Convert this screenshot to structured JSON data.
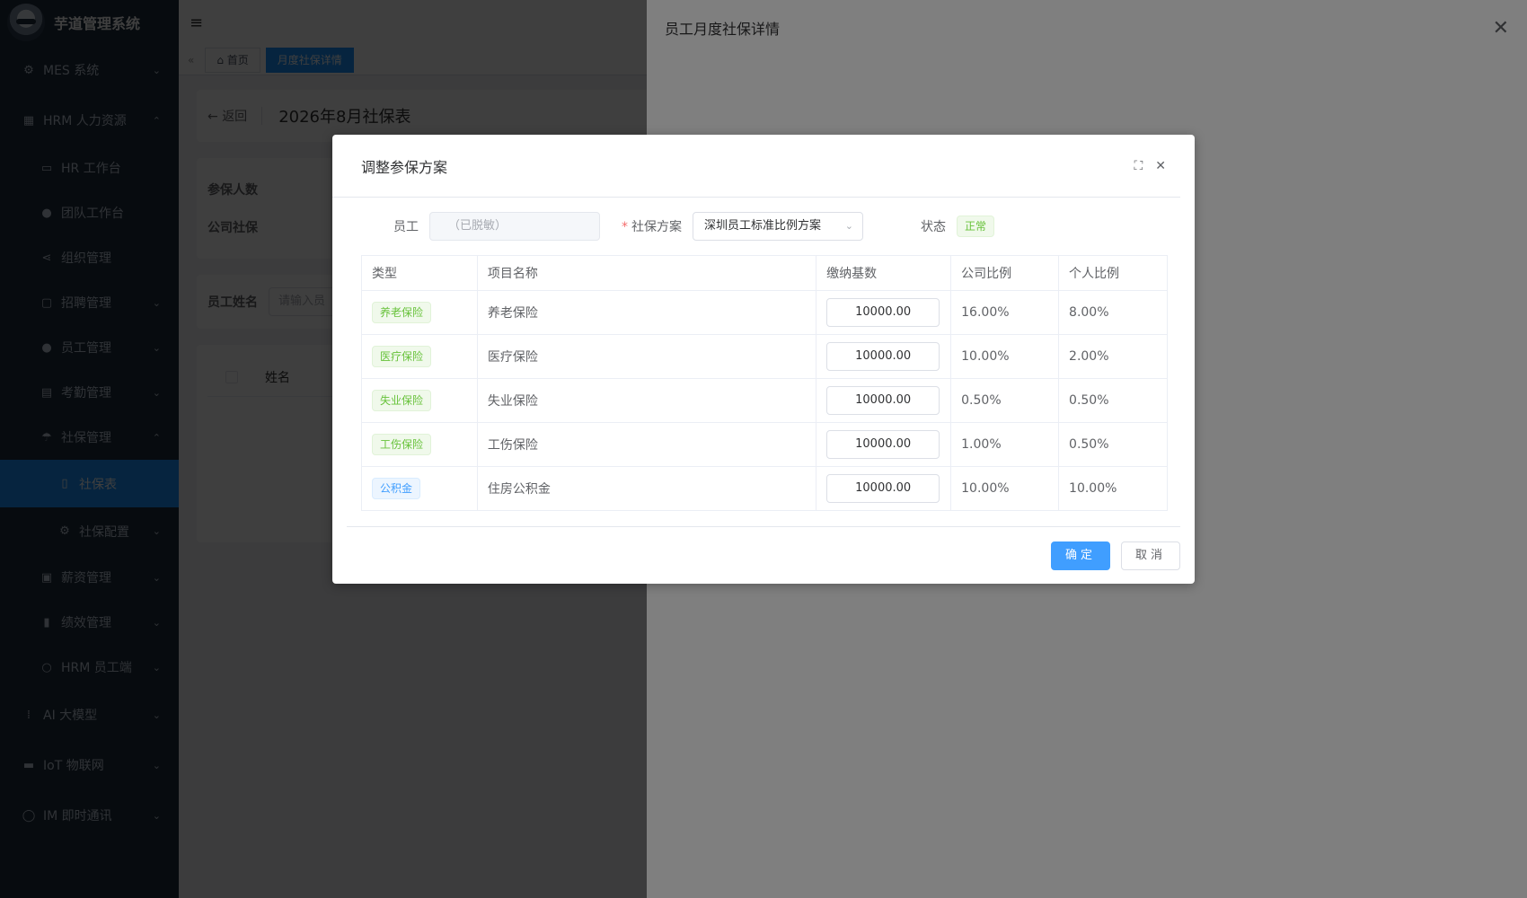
{
  "app": {
    "title": "芋道管理系统"
  },
  "sidebar": {
    "items": [
      {
        "label": "MES 系统",
        "icon": "gear-icon",
        "arrow": "⌄"
      },
      {
        "label": "HRM 人力资源",
        "icon": "building-icon",
        "arrow": "⌃"
      },
      {
        "label": "HR 工作台",
        "icon": "monitor-icon",
        "arrow": ""
      },
      {
        "label": "团队工作台",
        "icon": "user-icon",
        "arrow": ""
      },
      {
        "label": "组织管理",
        "icon": "share-icon",
        "arrow": ""
      },
      {
        "label": "招聘管理",
        "icon": "briefcase-icon",
        "arrow": "⌄"
      },
      {
        "label": "员工管理",
        "icon": "user-icon",
        "arrow": "⌄"
      },
      {
        "label": "考勤管理",
        "icon": "calendar-icon",
        "arrow": "⌄"
      },
      {
        "label": "社保管理",
        "icon": "umbrella-icon",
        "arrow": "⌃"
      },
      {
        "label": "社保表",
        "icon": "document-icon",
        "arrow": ""
      },
      {
        "label": "社保配置",
        "icon": "settings-icon",
        "arrow": "⌄"
      },
      {
        "label": "薪资管理",
        "icon": "money-icon",
        "arrow": "⌄"
      },
      {
        "label": "绩效管理",
        "icon": "bar-chart-icon",
        "arrow": "⌄"
      },
      {
        "label": "HRM 员工端",
        "icon": "user-icon",
        "arrow": "⌄"
      },
      {
        "label": "AI 大模型",
        "icon": "ai-icon",
        "arrow": "⌄"
      },
      {
        "label": "IoT 物联网",
        "icon": "iot-icon",
        "arrow": "⌄"
      },
      {
        "label": "IM 即时通讯",
        "icon": "chat-icon",
        "arrow": "⌄"
      }
    ]
  },
  "tags": {
    "home": "首页",
    "active": "月度社保详情"
  },
  "page": {
    "back": "返回",
    "title": "2026年8月社保表",
    "summary1": "参保人数",
    "summary2": "公司社保",
    "filter_label": "员工姓名",
    "filter_placeholder": "请输入员",
    "col_name": "姓名"
  },
  "drawer": {
    "title": "员工月度社保详情",
    "close": "✕"
  },
  "dialog": {
    "title": "调整参保方案",
    "employee_label": "员工",
    "employee_value": "（已脱敏）",
    "scheme_label": "社保方案",
    "scheme_value": "深圳员工标准比例方案",
    "status_label": "状态",
    "status_value": "正常",
    "columns": [
      "类型",
      "项目名称",
      "缴纳基数",
      "公司比例",
      "个人比例"
    ],
    "rows": [
      {
        "type": "养老保险",
        "name": "养老保险",
        "base": "10000.00",
        "company": "16.00%",
        "personal": "8.00%"
      },
      {
        "type": "医疗保险",
        "name": "医疗保险",
        "base": "10000.00",
        "company": "10.00%",
        "personal": "2.00%"
      },
      {
        "type": "失业保险",
        "name": "失业保险",
        "base": "10000.00",
        "company": "0.50%",
        "personal": "0.50%"
      },
      {
        "type": "工伤保险",
        "name": "工伤保险",
        "base": "10000.00",
        "company": "1.00%",
        "personal": "0.50%"
      },
      {
        "type": "公积金",
        "name": "住房公积金",
        "base": "10000.00",
        "company": "10.00%",
        "personal": "10.00%"
      }
    ],
    "confirm": "确定",
    "cancel": "取消"
  },
  "colors": {
    "primary": "#409eff",
    "success": "#67c23a",
    "sidebar_bg": "#1f2d3d"
  }
}
